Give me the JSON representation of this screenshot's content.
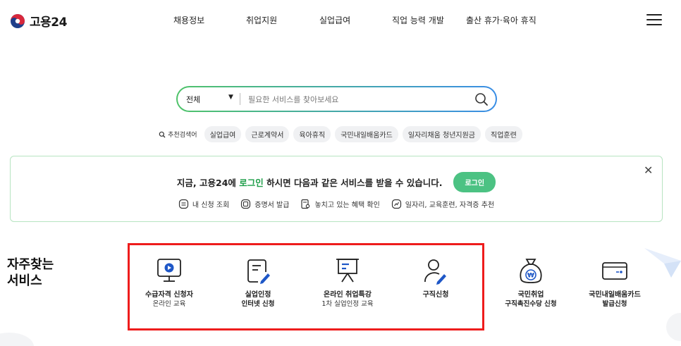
{
  "header": {
    "logo_text": "고용24",
    "nav": [
      "채용정보",
      "취업지원",
      "실업급여",
      "직업 능력 개발",
      "출산 휴가·육아 휴직"
    ],
    "menu_icon": "hamburger-icon"
  },
  "search": {
    "category": "전체",
    "placeholder": "필요한 서비스를 찾아보세요",
    "value": ""
  },
  "recommended": {
    "label": "추천검색어",
    "keywords": [
      "실업급여",
      "근로계약서",
      "육아휴직",
      "국민내일배움카드",
      "일자리채움 청년지원금",
      "직업훈련"
    ]
  },
  "login_banner": {
    "text_before": "지금, 고용24에 ",
    "text_highlight": "로그인",
    "text_after": " 하시면 다음과 같은 서비스를 받을 수 있습니다.",
    "login_button": "로그인",
    "benefits": [
      "내 신청 조회",
      "증명서 발급",
      "놓치고 있는 혜택 확인",
      "일자리, 교육훈련, 자격증 추천"
    ]
  },
  "services": {
    "title_line1": "자주찾는",
    "title_line2": "서비스",
    "items": [
      {
        "name": "수급자격 신청자",
        "sub": "온라인 교육",
        "icon": "monitor-play-icon"
      },
      {
        "name": "실업인정",
        "sub": "인터넷 신청",
        "icon": "document-pen-icon"
      },
      {
        "name": "온라인 취업특강",
        "sub": "1차 실업인정 교육",
        "icon": "presentation-board-icon"
      },
      {
        "name": "구직신청",
        "sub": "",
        "icon": "person-pen-icon"
      },
      {
        "name": "국민취업",
        "sub": "구직촉진수당 신청",
        "icon": "money-bag-icon"
      },
      {
        "name": "국민내일배움카드",
        "sub": "발급신청",
        "icon": "card-icon"
      }
    ]
  },
  "colors": {
    "accent_green": "#4cc283",
    "highlight_green": "#1f9e4a",
    "highlight_box": "#ee1c1c",
    "logo_red": "#d8283c",
    "logo_blue": "#1f3f8a"
  }
}
